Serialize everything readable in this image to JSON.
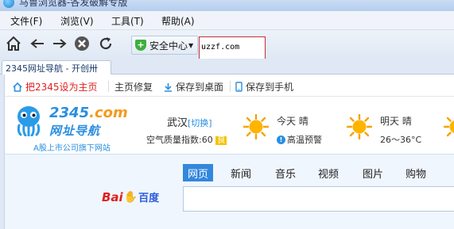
{
  "window": {
    "title": "马鲁浏览器-各发破解专版"
  },
  "menu": {
    "items": [
      {
        "label": "文件(F)"
      },
      {
        "label": "浏览(V)"
      },
      {
        "label": "工具(T)"
      },
      {
        "label": "帮助(A)"
      }
    ]
  },
  "toolbar": {
    "security_label": "安全中心",
    "address_value": "uzzf.com"
  },
  "tabs": [
    {
      "label": "2345网址导航 - 开创卅"
    }
  ],
  "links": {
    "set_home": "把2345设为主页",
    "home_repair": "主页修复",
    "save_desktop": "保存到桌面",
    "save_phone": "保存到手机"
  },
  "logo": {
    "number": "2345",
    "domain": ".com",
    "nav": "网址导航",
    "sub": "A股上市公司旗下网站"
  },
  "weather": {
    "city": "武汉",
    "switch": "[切换]",
    "aqi_label": "空气质量指数:",
    "aqi_value": "60",
    "aqi_grade": "良",
    "today": {
      "day": "今天",
      "cond": "晴",
      "note": "高温预警"
    },
    "tomorrow": {
      "day": "明天",
      "cond": "晴",
      "temp": "26～36°C"
    },
    "icon": "sun-icon"
  },
  "search": {
    "tabs": [
      "网页",
      "新闻",
      "音乐",
      "视频",
      "图片",
      "购物"
    ],
    "active_tab": "网页",
    "engine": {
      "bai": "Bai",
      "du": "百度"
    },
    "query": ""
  },
  "colors": {
    "accent": "#3387dd",
    "address_border": "#c0303a",
    "home_link": "#e02020",
    "baidu_red": "#e02020",
    "baidu_blue": "#2b5cd9"
  }
}
